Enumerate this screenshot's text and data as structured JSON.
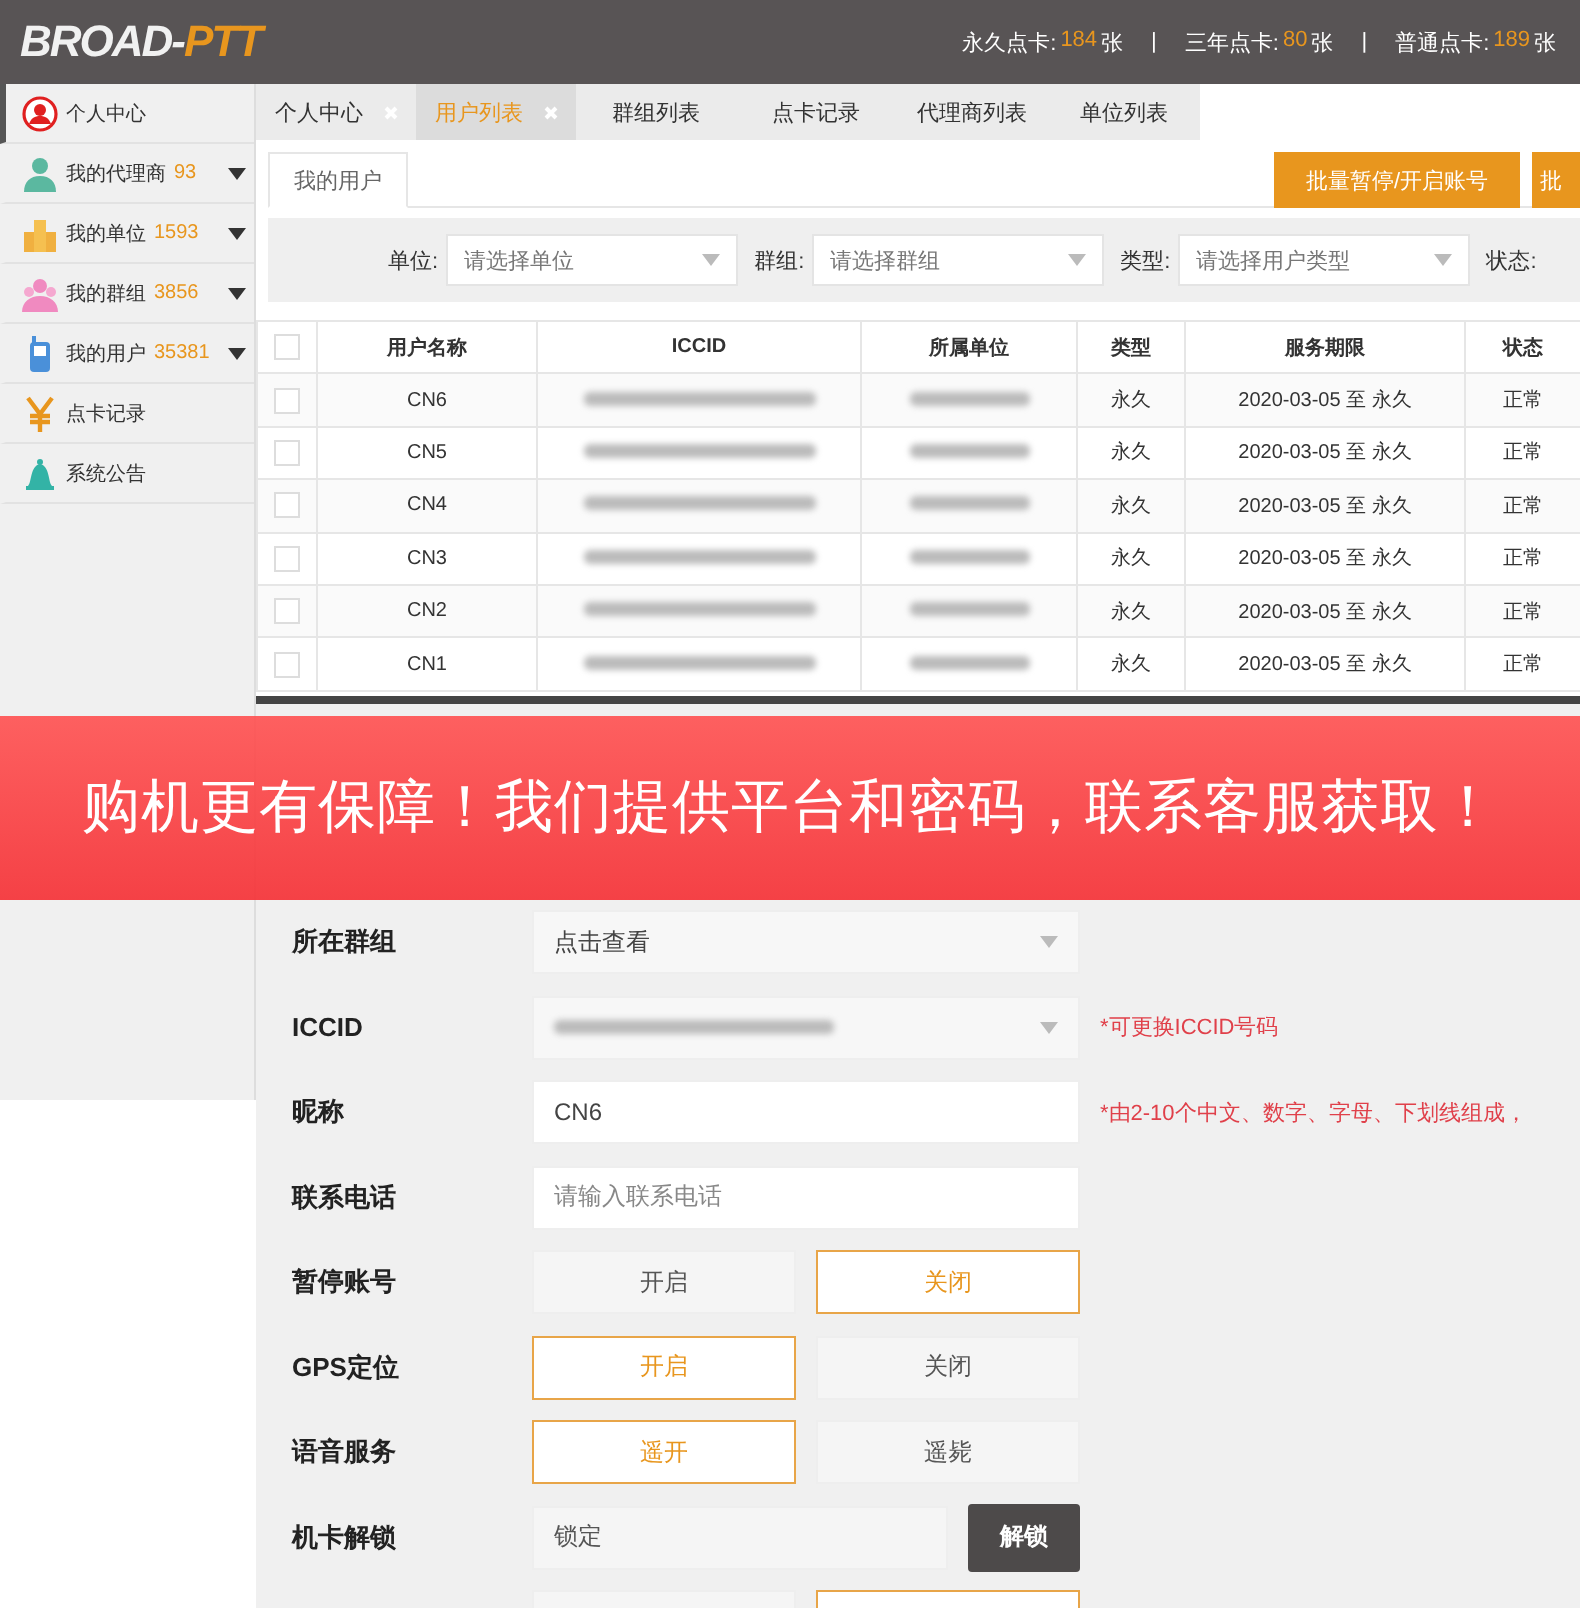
{
  "header": {
    "logo": {
      "main": "BROAD-",
      "accent": "PTT"
    },
    "divider": "|",
    "stats": [
      {
        "label": "永久点卡:",
        "count": "184",
        "unit": "张"
      },
      {
        "label": "三年点卡:",
        "count": "80",
        "unit": "张"
      },
      {
        "label": "普通点卡:",
        "count": "189",
        "unit": "张"
      }
    ]
  },
  "sidebar": {
    "items": [
      {
        "label": "个人中心",
        "selected": true,
        "expandable": false
      },
      {
        "label": "我的代理商",
        "count": "93",
        "selected": false,
        "expandable": true
      },
      {
        "label": "我的单位",
        "count": "1593",
        "selected": false,
        "expandable": true
      },
      {
        "label": "我的群组",
        "count": "3856",
        "selected": false,
        "expandable": true
      },
      {
        "label": "我的用户",
        "count": "35381",
        "selected": false,
        "expandable": true
      },
      {
        "label": "点卡记录",
        "selected": false,
        "expandable": false
      },
      {
        "label": "系统公告",
        "selected": false,
        "expandable": false
      }
    ]
  },
  "tabs": [
    {
      "label": "个人中心",
      "selected": false,
      "closable": true
    },
    {
      "label": "用户列表",
      "selected": true,
      "closable": true
    },
    {
      "label": "群组列表",
      "selected": false,
      "closable": false
    },
    {
      "label": "点卡记录",
      "selected": false,
      "closable": false
    },
    {
      "label": "代理商列表",
      "selected": false,
      "closable": false
    },
    {
      "label": "单位列表",
      "selected": false,
      "closable": false
    }
  ],
  "subtab": {
    "label": "我的用户",
    "selected": true
  },
  "actions": [
    "批量暂停/开启账号",
    "批"
  ],
  "filters": [
    {
      "label": "单位:",
      "placeholder": "请选择单位"
    },
    {
      "label": "群组:",
      "placeholder": "请选择群组"
    },
    {
      "label": "类型:",
      "placeholder": "请选择用户类型"
    },
    {
      "label": "状态:"
    }
  ],
  "table": {
    "header_checked": false,
    "columns": [
      {
        "label": "用户名称",
        "kind": "text"
      },
      {
        "label": "ICCID",
        "kind": "blurred"
      },
      {
        "label": "所属单位",
        "kind": "blurred"
      },
      {
        "label": "类型",
        "kind": "text"
      },
      {
        "label": "服务期限",
        "kind": "text"
      },
      {
        "label": "状态",
        "kind": "text"
      }
    ],
    "rows": [
      {
        "checked": false,
        "cells": [
          "CN6",
          "",
          "",
          "永久",
          "2020-03-05 至 永久",
          "正常"
        ]
      },
      {
        "checked": false,
        "cells": [
          "CN5",
          "",
          "",
          "永久",
          "2020-03-05 至 永久",
          "正常"
        ]
      },
      {
        "checked": false,
        "cells": [
          "CN4",
          "",
          "",
          "永久",
          "2020-03-05 至 永久",
          "正常"
        ]
      },
      {
        "checked": false,
        "cells": [
          "CN3",
          "",
          "",
          "永久",
          "2020-03-05 至 永久",
          "正常"
        ]
      },
      {
        "checked": false,
        "cells": [
          "CN2",
          "",
          "",
          "永久",
          "2020-03-05 至 永久",
          "正常"
        ]
      },
      {
        "checked": false,
        "cells": [
          "CN1",
          "",
          "",
          "永久",
          "2020-03-05 至 永久",
          "正常"
        ]
      }
    ]
  },
  "edit_panel": {
    "fields": [
      {
        "kind": "select",
        "label": "所在群组",
        "value": "点击查看"
      },
      {
        "kind": "select",
        "label": "ICCID",
        "blurred": true,
        "hint": "*可更换ICCID号码"
      },
      {
        "kind": "input",
        "label": "昵称",
        "value": "CN6",
        "hint": "*由2-10个中文、数字、字母、下划线组成，"
      },
      {
        "kind": "input",
        "label": "联系电话",
        "placeholder": "请输入联系电话"
      },
      {
        "kind": "toggle",
        "label": "暂停账号",
        "options": [
          {
            "label": "开启",
            "selected": false
          },
          {
            "label": "关闭",
            "selected": true
          }
        ]
      },
      {
        "kind": "toggle",
        "label": "GPS定位",
        "options": [
          {
            "label": "开启",
            "selected": true
          },
          {
            "label": "关闭",
            "selected": false
          }
        ]
      },
      {
        "kind": "toggle",
        "label": "语音服务",
        "options": [
          {
            "label": "遥开",
            "selected": true
          },
          {
            "label": "遥毙",
            "selected": false
          }
        ]
      },
      {
        "kind": "unlock",
        "label": "机卡解锁",
        "value": "锁定",
        "button": "解锁"
      },
      {
        "kind": "toggle",
        "options": [
          {
            "selected": false
          },
          {
            "selected": true
          }
        ]
      }
    ]
  },
  "banner": {
    "text": "购机更有保障！我们提供平台和密码，联系客服获取！"
  }
}
